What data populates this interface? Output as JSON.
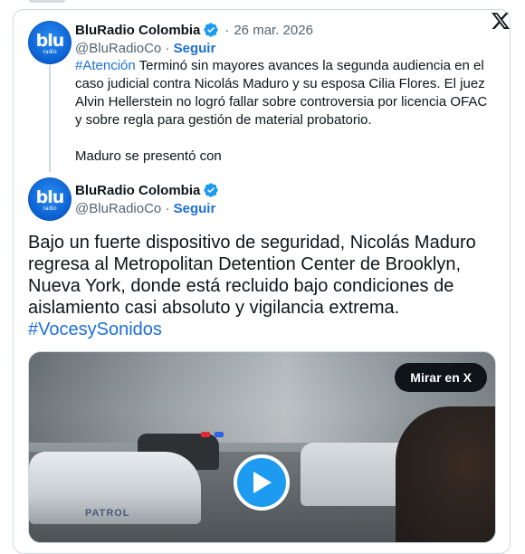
{
  "colors": {
    "accent": "#1d6fd8",
    "verified": "#1d9bf0",
    "muted": "#536471",
    "border": "#cfd9de"
  },
  "quoted_tweet": {
    "avatar_logo": "blu",
    "avatar_sub": "radio",
    "name": "BluRadio Colombia",
    "date": "26 mar. 2026",
    "handle": "@BluRadioCo",
    "follow_label": "Seguir",
    "hashtag": "#Atención",
    "text": " Terminó sin mayores avances la segunda audiencia en el caso judicial contra Nicolás Maduro y su esposa Cilia Flores. El juez Alvin Hellerstein no logró fallar sobre controversia por licencia OFAC y sobre regla para gestión de material probatorio.",
    "text_tail": "Maduro se presentó con"
  },
  "main_tweet": {
    "avatar_logo": "blu",
    "avatar_sub": "radio",
    "name": "BluRadio Colombia",
    "handle": "@BluRadioCo",
    "follow_label": "Seguir",
    "text": "Bajo un fuerte dispositivo de seguridad, Nicolás Maduro regresa al Metropolitan Detention Center de Brooklyn, Nueva York, donde está recluido bajo condiciones de aislamiento casi absoluto y vigilancia extrema.",
    "hashtag": "#VocesySonidos"
  },
  "media": {
    "watch_label": "Mirar en X",
    "vehicle_text": "PATROL",
    "icon": "play-icon"
  },
  "icons": {
    "x_logo": "x-logo-icon",
    "verified": "verified-badge-icon"
  }
}
